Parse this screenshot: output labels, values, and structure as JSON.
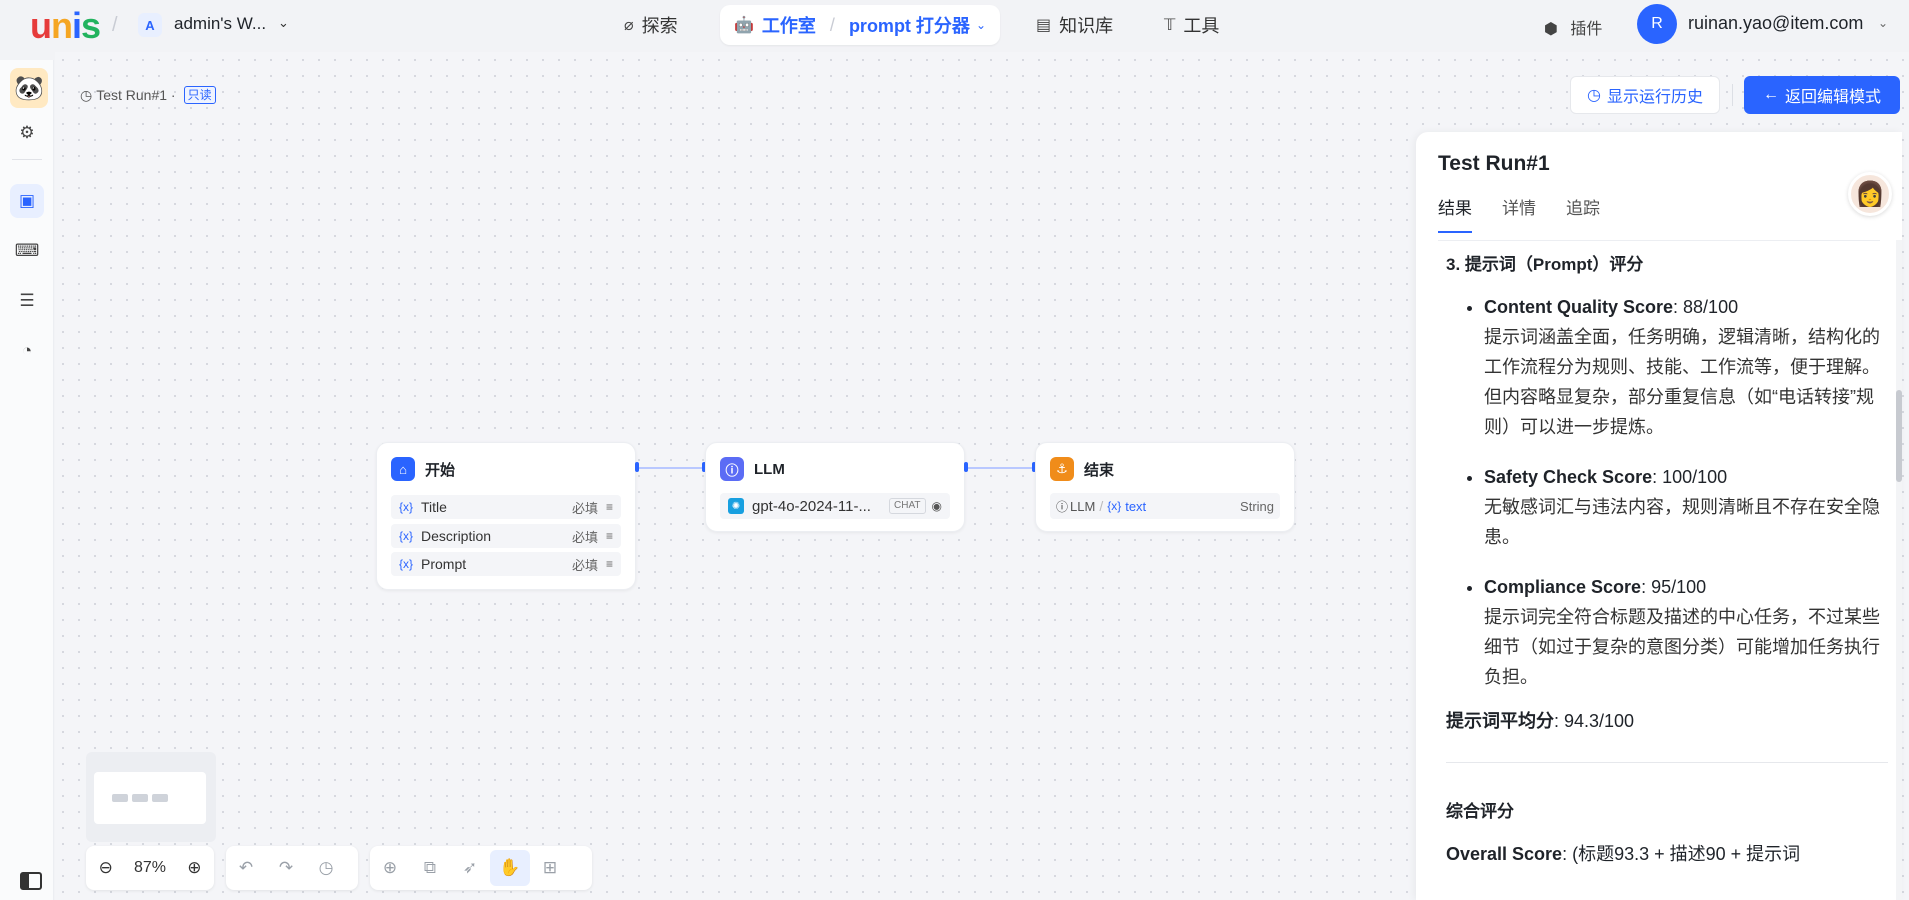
{
  "topbar": {
    "logo": [
      "u",
      "n",
      "i",
      "s"
    ],
    "workspace_initial": "A",
    "workspace_name": "admin's W...",
    "nav_explore": "探索",
    "nav_studio": "工作室",
    "nav_studio_sub": "prompt 打分器",
    "nav_kb": "知识库",
    "nav_tools": "工具",
    "plugins": "插件",
    "user_initial": "R",
    "user_email": "ruinan.yao@item.com"
  },
  "canvas": {
    "run_label": "Test Run#1 ·",
    "readonly_badge": "只读",
    "show_history": "显示运行历史",
    "back_to_edit": "返回编辑模式",
    "zoom": "87%"
  },
  "nodes": {
    "start": {
      "title": "开始",
      "rows": [
        {
          "var": "{x}",
          "name": "Title",
          "req": "必填"
        },
        {
          "var": "{x}",
          "name": "Description",
          "req": "必填"
        },
        {
          "var": "{x}",
          "name": "Prompt",
          "req": "必填"
        }
      ]
    },
    "llm": {
      "title": "LLM",
      "model": "gpt-4o-2024-11-...",
      "mode": "CHAT"
    },
    "end": {
      "title": "结束",
      "source": "LLM",
      "var": "{x}",
      "var_name": "text",
      "type": "String"
    }
  },
  "panel": {
    "title": "Test Run#1",
    "tabs": [
      "结果",
      "详情",
      "追踪"
    ],
    "section_heading": "3. 提示词（Prompt）评分",
    "items": [
      {
        "label": "Content Quality Score",
        "score": ": 88/100",
        "desc": "提示词涵盖全面，任务明确，逻辑清晰，结构化的工作流程分为规则、技能、工作流等，便于理解。但内容略显复杂，部分重复信息（如“电话转接”规则）可以进一步提炼。"
      },
      {
        "label": "Safety Check Score",
        "score": ": 100/100",
        "desc": "无敏感词汇与违法内容，规则清晰且不存在安全隐患。"
      },
      {
        "label": "Compliance Score",
        "score": ": 95/100",
        "desc": "提示词完全符合标题及描述的中心任务，不过某些细节（如过于复杂的意图分类）可能增加任务执行负担。"
      }
    ],
    "avg_label": "提示词平均分",
    "avg_value": ": 94.3/100",
    "overall_heading": "综合评分",
    "overall_label": "Overall Score",
    "overall_value": ": (标题93.3 + 描述90 + 提示词"
  },
  "colors": {
    "accent": "#2a64ff",
    "start_node": "#2a64ff",
    "llm_node": "#5b6cf5",
    "end_node": "#f08c1a"
  }
}
